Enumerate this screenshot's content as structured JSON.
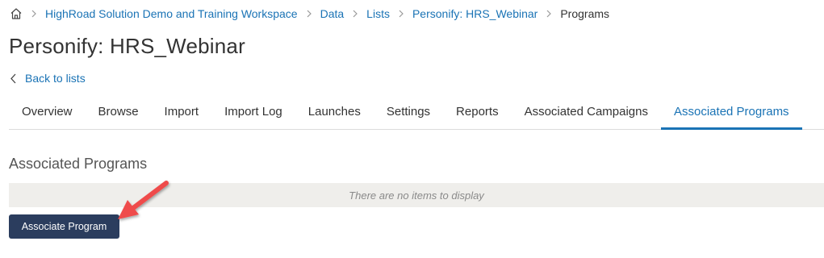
{
  "breadcrumb": {
    "home_icon": "home-icon",
    "items": [
      "HighRoad Solution Demo and Training Workspace",
      "Data",
      "Lists",
      "Personify: HRS_Webinar"
    ],
    "current": "Programs"
  },
  "page": {
    "title": "Personify: HRS_Webinar",
    "back_link": "Back to lists"
  },
  "tabs": [
    {
      "label": "Overview",
      "active": false
    },
    {
      "label": "Browse",
      "active": false
    },
    {
      "label": "Import",
      "active": false
    },
    {
      "label": "Import Log",
      "active": false
    },
    {
      "label": "Launches",
      "active": false
    },
    {
      "label": "Settings",
      "active": false
    },
    {
      "label": "Reports",
      "active": false
    },
    {
      "label": "Associated Campaigns",
      "active": false
    },
    {
      "label": "Associated Programs",
      "active": true
    }
  ],
  "section": {
    "title": "Associated Programs",
    "empty_message": "There are no items to display",
    "associate_button": "Associate Program"
  },
  "colors": {
    "link": "#1a73b5",
    "button": "#2b3d5e",
    "arrow": "#ef4b4b",
    "empty_row": "#efeeeb"
  }
}
